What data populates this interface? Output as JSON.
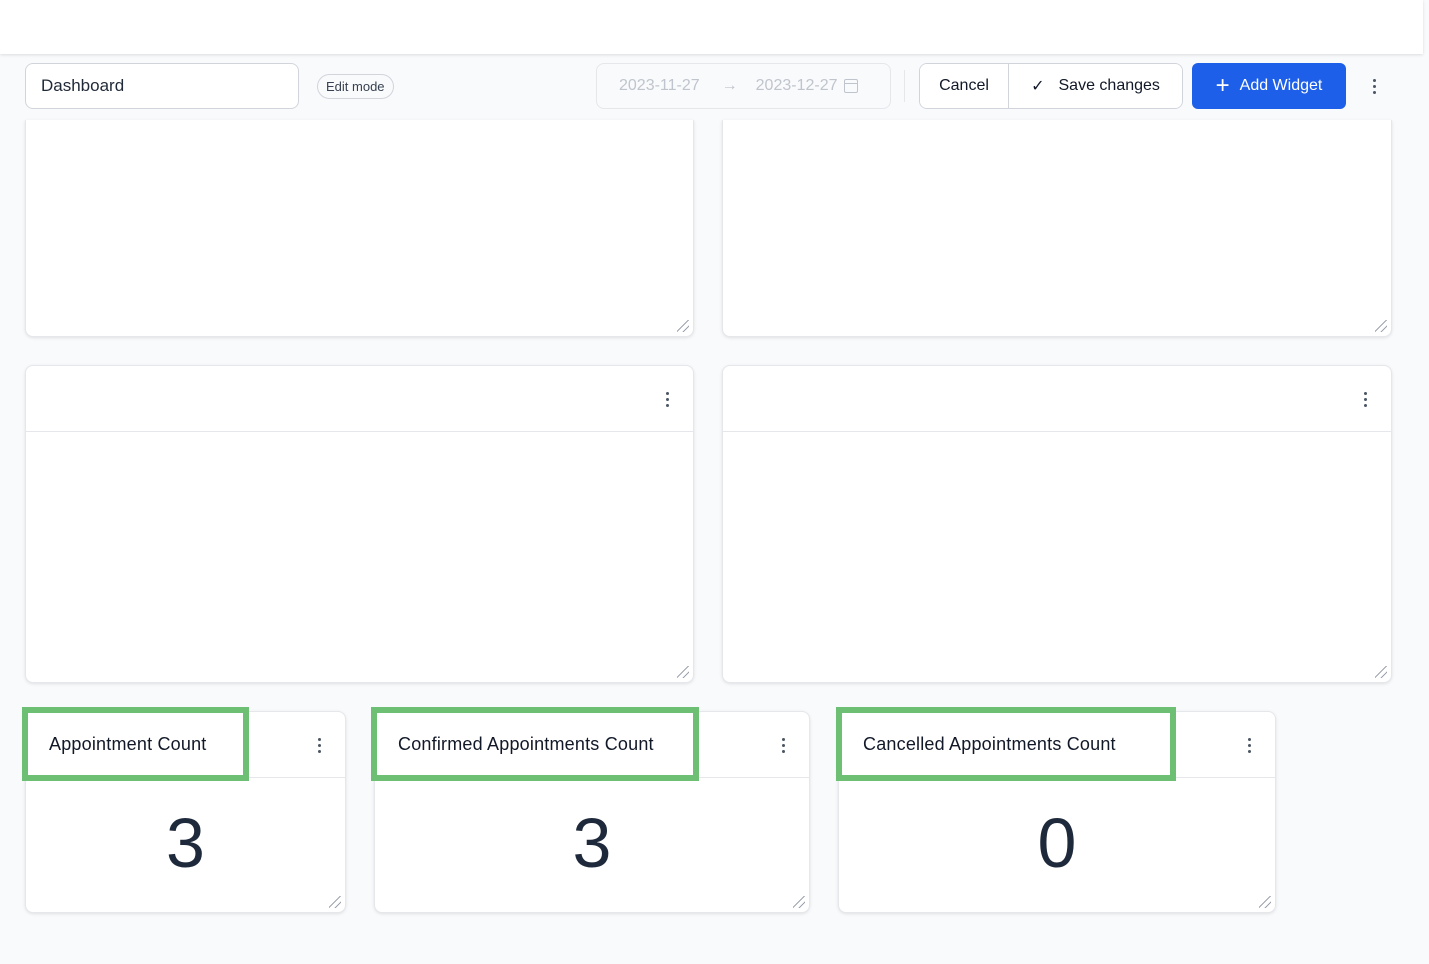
{
  "toolbar": {
    "dashboard_name": "Dashboard",
    "mode_badge": "Edit mode",
    "date_start": "2023-11-27",
    "date_end": "2023-12-27",
    "cancel_label": "Cancel",
    "save_label": "Save changes",
    "add_widget_label": "Add Widget"
  },
  "icons": {
    "calendar": "calendar-icon",
    "arrow": "arrow-right-icon",
    "check": "check-icon",
    "plus": "plus-icon",
    "more": "more-vertical-icon",
    "resize": "resize-handle-icon"
  },
  "colors": {
    "accent": "#1d5fe8",
    "highlight": "#6dbf73",
    "page_bg": "#f8fafc"
  },
  "kpi_widgets": [
    {
      "title": "Appointment Count",
      "value": "3"
    },
    {
      "title": "Confirmed Appointments Count",
      "value": "3"
    },
    {
      "title": "Cancelled Appointments Count",
      "value": "0"
    }
  ]
}
